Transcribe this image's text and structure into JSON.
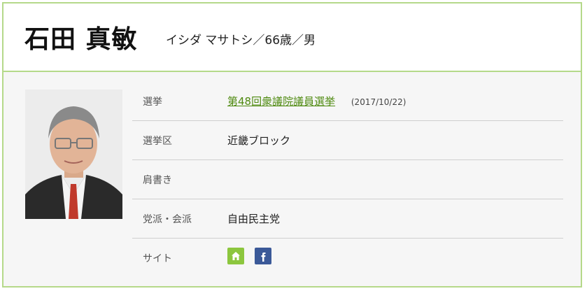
{
  "profile": {
    "name": "石田 真敏",
    "kana_age_gender": "イシダ マサトシ／66歳／男"
  },
  "details": [
    {
      "label": "選挙",
      "value": "第48回衆議院議員選挙",
      "date": "(2017/10/22)"
    },
    {
      "label": "選挙区",
      "value": "近畿ブロック"
    },
    {
      "label": "肩書き",
      "value": ""
    },
    {
      "label": "党派・会派",
      "value": "自由民主党"
    },
    {
      "label": "サイト"
    }
  ],
  "icons": {
    "home": "home-icon",
    "facebook": "facebook-icon"
  },
  "colors": {
    "accent_border": "#b5d98a",
    "link_green": "#4f8a10",
    "home_green": "#8cc63e",
    "facebook_blue": "#3b5998"
  }
}
